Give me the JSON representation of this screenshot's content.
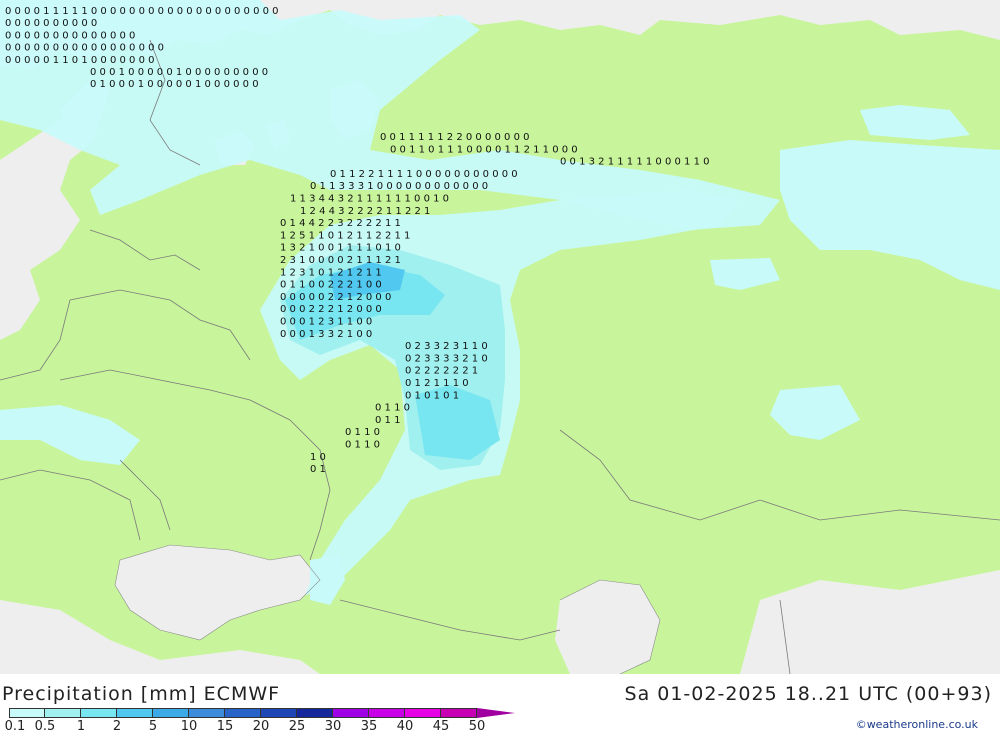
{
  "header": {
    "title": "Precipitation [mm] ECMWF",
    "datetime": "Sa 01-02-2025 18..21 UTC (00+93)",
    "credit": "©weatheronline.co.uk"
  },
  "legend": {
    "labels": [
      "0.1",
      "0.5",
      "1",
      "2",
      "5",
      "10",
      "15",
      "20",
      "25",
      "30",
      "35",
      "40",
      "45",
      "50"
    ],
    "colors": [
      "#c8fafa",
      "#a0f0f0",
      "#78e6f0",
      "#50c8f0",
      "#3caae6",
      "#3c8cdc",
      "#2864c8",
      "#1e46b4",
      "#14289b",
      "#a000e6",
      "#c800e6",
      "#e600e6",
      "#c800b4",
      "#a000a0"
    ]
  },
  "map": {
    "land_color": "#c8f59b",
    "sea_color": "#eeeeee",
    "precip_colors": {
      "light": "#c8fafa",
      "mid": "#a0f0f0",
      "strong": "#78e6f0",
      "heavy": "#50c8f0"
    },
    "grid_labels": [
      {
        "row": 0,
        "values": "0 0     0 0 1 1 1 1 1 0 0   0 0 0 0 0 0 0                0 0 0 0 0 0 0 0 0 0 0"
      },
      {
        "row": 1,
        "values": "0 0     0 0 0   0 0 0         0 0"
      },
      {
        "row": 2,
        "values": "0 0 0 0   0 0 0   0     0       0       0                    0                       0 0"
      },
      {
        "row": 3,
        "values": "0 0 0     0 0 0 0   0 0 0 0 0 0 0 0 0 0"
      },
      {
        "row": 4,
        "values": "0 0   0 0   0 1 1 0 1 0 0 0   0 0 0 0"
      },
      {
        "row": 5,
        "values": "0 0 0 1 0 0 0 0 0 1 0 0 0 0 0 0 0 0 0"
      },
      {
        "row": 6,
        "values": "0 1 0   0 0 1 0 0 0 0 0 1 0 0 0 0   0         0"
      },
      {
        "row": 7,
        "values": "0 0 1 1 1 1 1 2 2 0 0 0 0 0 0 0"
      },
      {
        "row": 8,
        "values": "0 0 1 1 0 1 1 1 0 0 0 0 1 1 2 1 1 0 0 0"
      },
      {
        "row": 9,
        "values": "0 0 1 3 2 1 1 1 1 1 0 0 0 1 1 0"
      },
      {
        "row": 10,
        "values": "0 1 1 2 2 1 1 1 1 0 0 0 0 0 0 0 0 0 0 0"
      },
      {
        "row": 11,
        "values": "0 1 1 3 3 3 1 0 0 0 0 0 0 0 0 0 0 0 0"
      },
      {
        "row": 12,
        "values": "1 1 3 4 4 3 2 1 1 1 1 1 1 0 0 1 0"
      },
      {
        "row": 13,
        "values": "1 2 4 4 3 2 2 2 2 1 1 2 2 1"
      },
      {
        "row": 14,
        "values": "0 1 4 4 2 2 3 2 2 2 2 1 1"
      },
      {
        "row": 15,
        "values": "1 2 5 1 1 0 1 2 1 1 2 2 1 1"
      },
      {
        "row": 16,
        "values": "1 3 2 1 0   0 1 1 1 1 0 1 0"
      },
      {
        "row": 17,
        "values": "2 3 1 0 0   0 0 2 1 1 1 2 1"
      },
      {
        "row": 18,
        "values": "1 2 3 1     0 1 2 1 2 1 1"
      },
      {
        "row": 19,
        "values": "0 1 1 0     0 2 2 2 1 0 0"
      },
      {
        "row": 20,
        "values": "0 0 0 0     0 2 2 1 2 0 0 0"
      },
      {
        "row": 21,
        "values": "0 0         0 2 2 2 1 2 0 0 0"
      },
      {
        "row": 22,
        "values": "0 0         0 1 2 3 1 1 0 0"
      },
      {
        "row": 23,
        "values": "0     0     0 1 3 3 2 1 0 0"
      },
      {
        "row": 24,
        "values": "0 2 3 3 2 3 1 1 0"
      },
      {
        "row": 25,
        "values": "0 2 3 3 3 3 2 1 0"
      },
      {
        "row": 26,
        "values": "0 2 2 2 2 2 2 1"
      },
      {
        "row": 27,
        "values": "0 1 2 1 1 1 0"
      },
      {
        "row": 28,
        "values": "0 1 0 1 0 1"
      },
      {
        "row": 29,
        "values": "0 1 1 0"
      },
      {
        "row": 30,
        "values": "0 1 1"
      },
      {
        "row": 31,
        "values": "0 1 1 0"
      },
      {
        "row": 32,
        "values": "0 1 1 0"
      },
      {
        "row": 33,
        "values": "1 0"
      },
      {
        "row": 34,
        "values": "0 1"
      }
    ]
  }
}
